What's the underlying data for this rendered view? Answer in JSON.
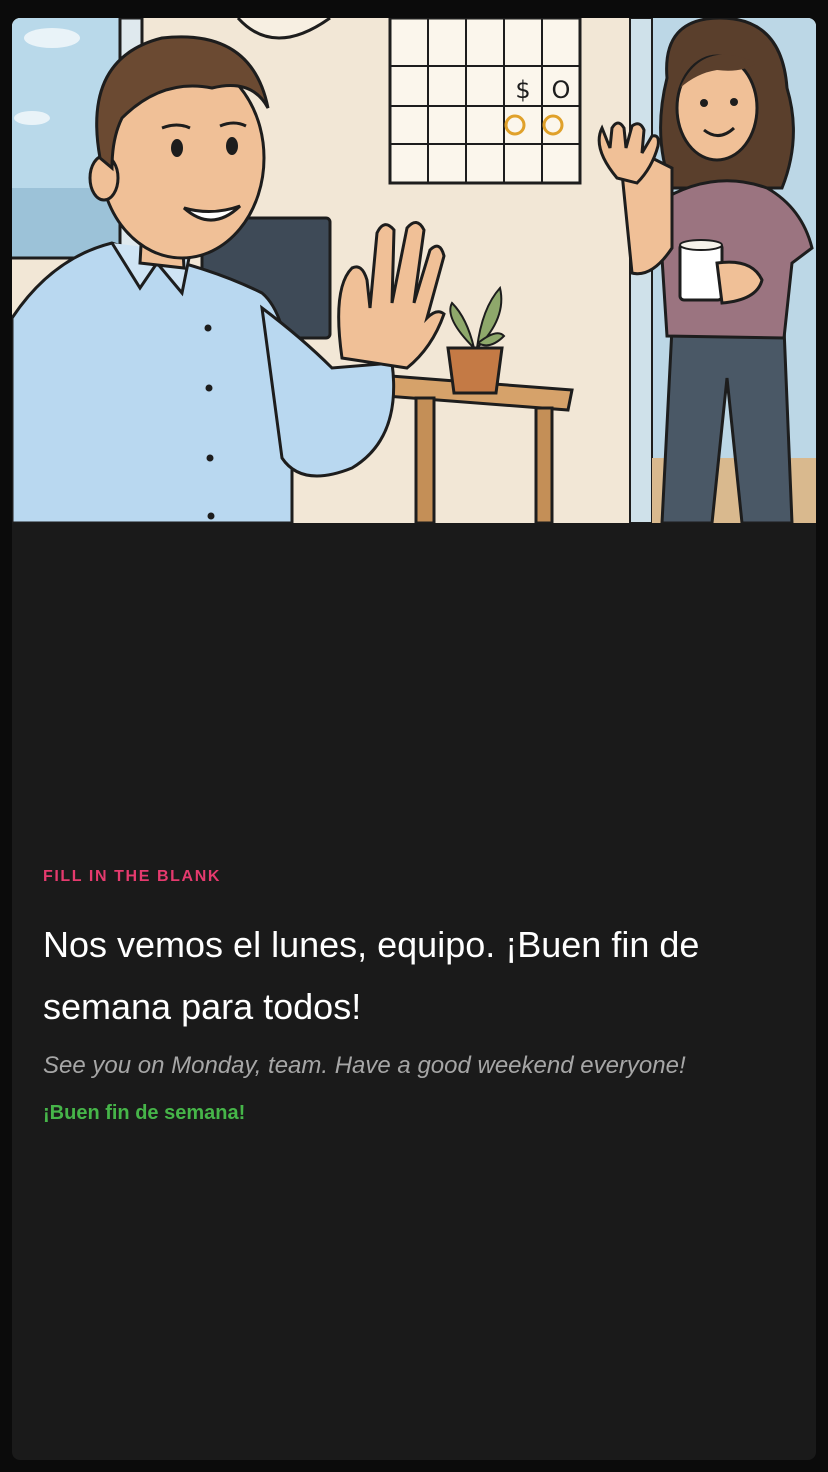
{
  "exercise": {
    "label": "FILL IN THE BLANK",
    "sentence": "Nos vemos el lunes, equipo. ¡Buen fin de semana para todos!",
    "translation": "See you on Monday, team. Have a good weekend everyone!",
    "answer": "¡Buen fin de semana!"
  },
  "illustration": {
    "calendar_cell_1": "$",
    "calendar_cell_2": "O"
  },
  "colors": {
    "background": "#1a1a1a",
    "label": "#e53a6e",
    "answer": "#46b549",
    "translation": "#a6a6a6"
  }
}
